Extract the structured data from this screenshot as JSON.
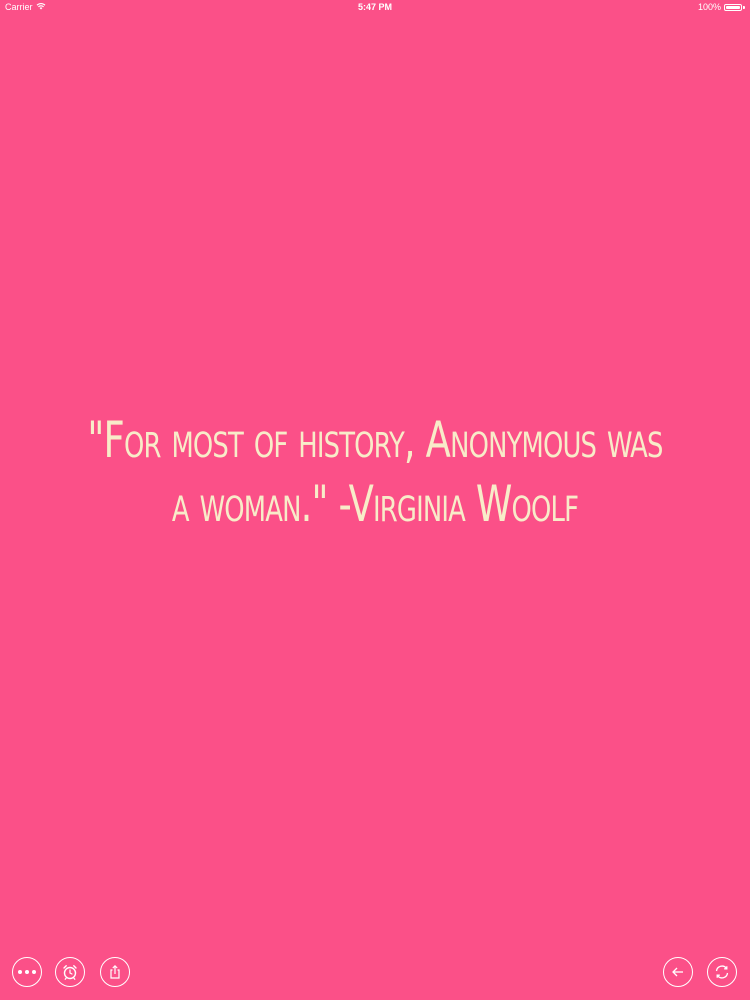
{
  "status_bar": {
    "carrier": "Carrier",
    "time": "5:47 PM",
    "battery": "100%",
    "battery_level": 1.0
  },
  "quote": {
    "text": "\"For most of history, Anonymous was a woman.\" -Virginia Woolf"
  },
  "toolbar": {
    "left_buttons": [
      "more-icon",
      "alarm-clock-icon",
      "share-icon"
    ],
    "right_buttons": [
      "back-arrow-icon",
      "refresh-icon"
    ]
  },
  "colors": {
    "background": "#fb5088",
    "quote_text": "#f8ecc9",
    "chrome": "#ffffff"
  }
}
